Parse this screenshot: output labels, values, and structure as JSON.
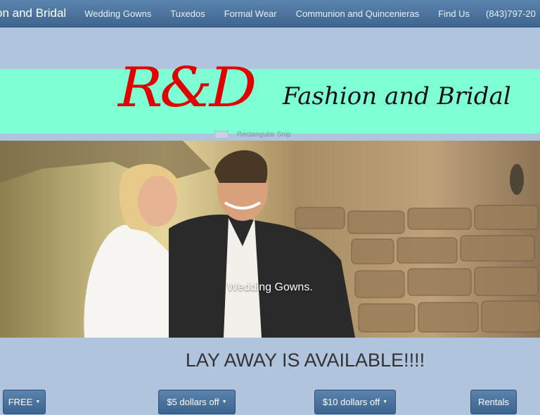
{
  "navbar": {
    "brand": "on and Bridal",
    "items": [
      "Wedding Gowns",
      "Tuxedos",
      "Formal Wear",
      "Communion and Quincenieras",
      "Find Us"
    ],
    "phone": "(843)797-20"
  },
  "banner": {
    "logo_initials": "R&D",
    "logo_text": "Fashion and Bridal",
    "snip_text": "Rectangular Snip"
  },
  "carousel": {
    "caption": "Wedding Gowns."
  },
  "promo": {
    "headline": "LAY AWAY IS AVAILABLE!!!!"
  },
  "buttons": {
    "free": "FREE",
    "five_off": "$5 dollars off",
    "ten_off": "$10 dollars off",
    "rentals": "Rentals"
  },
  "colors": {
    "background": "#b0c4de",
    "banner": "#7fffd4",
    "logo_red": "#e00000",
    "navbar": "#4a71a0"
  }
}
